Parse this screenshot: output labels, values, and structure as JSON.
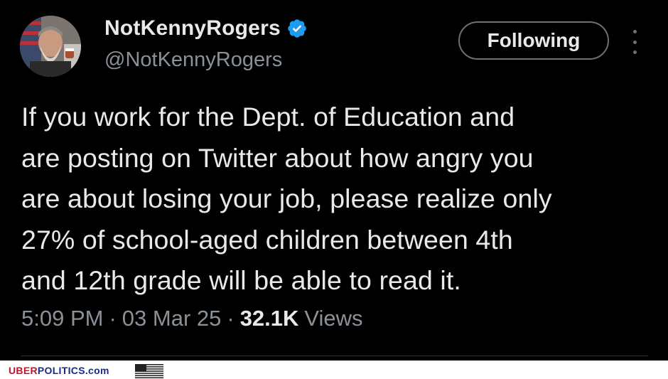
{
  "profile": {
    "display_name": "NotKennyRogers",
    "handle": "@NotKennyRogers",
    "verified": true,
    "verified_color": "#1d9bf0"
  },
  "actions": {
    "follow_label": "Following",
    "more_icon": "more-vertical-icon"
  },
  "tweet": {
    "lines": [
      "If you work for the Dept. of Education and",
      "are posting on Twitter about how angry you",
      "are about losing your job, please realize only",
      "27% of school-aged children between 4th",
      "and 12th grade will be able to read it."
    ]
  },
  "meta": {
    "time": "5:09 PM",
    "separator": "·",
    "date": "03 Mar 25",
    "views_count": "32.1K",
    "views_label": "Views"
  },
  "watermark": {
    "brand_part1": "UBER",
    "brand_part2": "POLITICS.com",
    "brand_color_1": "#c8102e",
    "brand_color_2": "#1a2a8a",
    "flag_icon": "us-flag-icon"
  },
  "colors": {
    "background": "#000000",
    "text": "#e7e9ea",
    "secondary": "#8b9198"
  }
}
